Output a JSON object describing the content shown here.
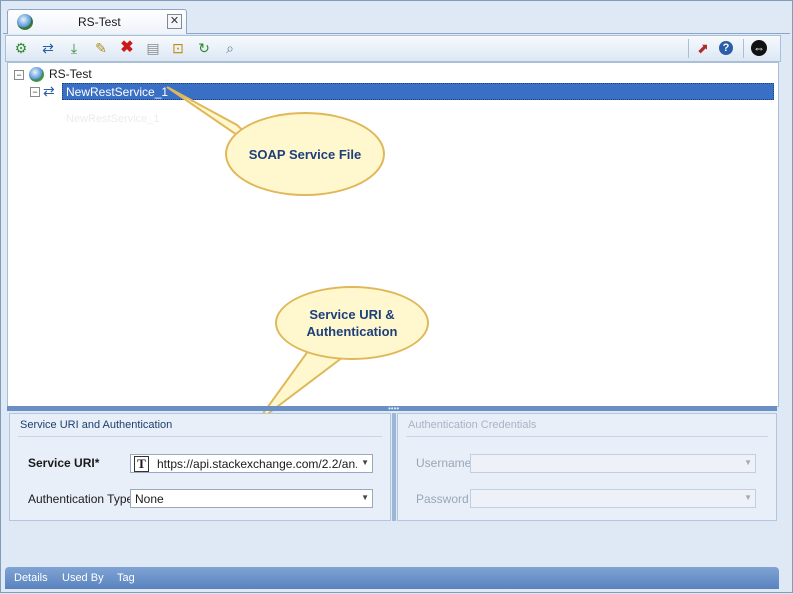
{
  "tab": {
    "title": "RS-Test",
    "close": "✕"
  },
  "toolbar": {
    "icons": [
      "add-icon",
      "refresh-icon",
      "import-icon",
      "edit-icon",
      "delete-icon",
      "save-icon",
      "lock-icon",
      "sync-icon",
      "search-icon",
      "export-icon",
      "help-icon",
      "navigate-icon"
    ]
  },
  "tree": {
    "root": "RS-Test",
    "child": "NewRestService_1",
    "ghost": "NewRestService_1"
  },
  "callouts": {
    "soap": "SOAP Service File",
    "uri_line1": "Service URI &",
    "uri_line2": "Authentication"
  },
  "service_panel": {
    "title": "Service URI and Authentication",
    "uri_label": "Service URI*",
    "uri_type": "T",
    "uri_value": "https://api.stackexchange.com/2.2/an...",
    "auth_label": "Authentication Type",
    "auth_value": "None"
  },
  "credentials_panel": {
    "title": "Authentication Credentials",
    "username_label": "Username",
    "password_label": "Password"
  },
  "statusbar": {
    "details": "Details",
    "used_by": "Used By",
    "tag": "Tag"
  },
  "colors": {
    "selection": "#3a6fc6",
    "callout_fill": "#fff8cf",
    "callout_border": "#e0b85a",
    "callout_text": "#1e3f7a"
  }
}
